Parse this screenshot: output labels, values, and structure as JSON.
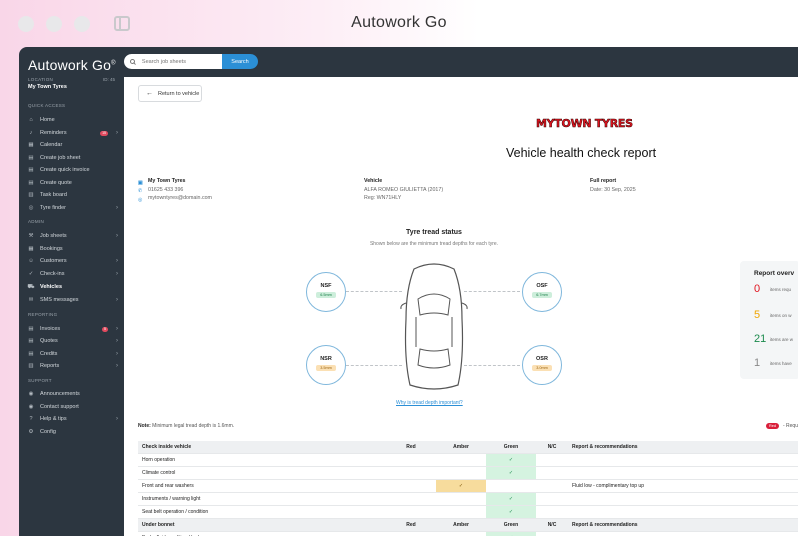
{
  "window": {
    "title": "Autowork Go"
  },
  "sidebar": {
    "logo": "Autowork Go",
    "logo_mark": "®",
    "location_label": "LOCATION",
    "location_id": "ID: 45",
    "location_name": "My Town Tyres",
    "sections": [
      {
        "label": "QUICK ACCESS",
        "items": [
          {
            "label": "Home",
            "icon": "home-icon",
            "glyph": "⌂"
          },
          {
            "label": "Reminders",
            "icon": "bell-icon",
            "glyph": "♪",
            "badge": "15",
            "chevron": true
          },
          {
            "label": "Calendar",
            "icon": "calendar-icon",
            "glyph": "▦"
          },
          {
            "label": "Create job sheet",
            "icon": "document-icon",
            "glyph": "▤"
          },
          {
            "label": "Create quick invoice",
            "icon": "document-icon",
            "glyph": "▤"
          },
          {
            "label": "Create quote",
            "icon": "document-icon",
            "glyph": "▤"
          },
          {
            "label": "Task board",
            "icon": "board-icon",
            "glyph": "▥"
          },
          {
            "label": "Tyre finder",
            "icon": "search-icon",
            "glyph": "◎",
            "chevron": true
          }
        ]
      },
      {
        "label": "ADMIN",
        "items": [
          {
            "label": "Job sheets",
            "icon": "wrench-icon",
            "glyph": "⚒",
            "chevron": true
          },
          {
            "label": "Bookings",
            "icon": "calendar-icon",
            "glyph": "▦"
          },
          {
            "label": "Customers",
            "icon": "users-icon",
            "glyph": "☺",
            "chevron": true
          },
          {
            "label": "Check-ins",
            "icon": "checkin-icon",
            "glyph": "✓",
            "chevron": true
          },
          {
            "label": "Vehicles",
            "icon": "car-icon",
            "glyph": "⛟",
            "active": true
          },
          {
            "label": "SMS messages",
            "icon": "message-icon",
            "glyph": "✉",
            "chevron": true
          }
        ]
      },
      {
        "label": "REPORTING",
        "items": [
          {
            "label": "Invoices",
            "icon": "invoice-icon",
            "glyph": "▤",
            "badge": "5",
            "chevron": true
          },
          {
            "label": "Quotes",
            "icon": "quote-icon",
            "glyph": "▤",
            "chevron": true
          },
          {
            "label": "Credits",
            "icon": "credit-icon",
            "glyph": "▤",
            "chevron": true
          },
          {
            "label": "Reports",
            "icon": "chart-icon",
            "glyph": "▥",
            "chevron": true
          }
        ]
      },
      {
        "label": "SUPPORT",
        "items": [
          {
            "label": "Announcements",
            "icon": "megaphone-icon",
            "glyph": "◉"
          },
          {
            "label": "Contact support",
            "icon": "support-icon",
            "glyph": "◉"
          },
          {
            "label": "Help & tips",
            "icon": "help-icon",
            "glyph": "?",
            "chevron": true
          },
          {
            "label": "Config",
            "icon": "gear-icon",
            "glyph": "⚙"
          }
        ]
      }
    ]
  },
  "search": {
    "placeholder": "Search job sheets",
    "button": "Search"
  },
  "page": {
    "back_label": "Return to vehicle",
    "brand_logo_text": "MYTOWN TYRES",
    "title": "Vehicle health check report",
    "company": {
      "name": "My Town Tyres",
      "phone": "01625 433 396",
      "email": "mytowntyres@domain.com"
    },
    "vehicle": {
      "heading": "Vehicle",
      "model": "ALFA ROMEO GIULIETTA (2017)",
      "reg": "Reg: WN71HLY"
    },
    "report": {
      "heading": "Full report",
      "date": "Date: 30 Sep, 2025"
    },
    "tread": {
      "title": "Tyre tread status",
      "subtitle": "Shown below are the minimum tread depths for each tyre.",
      "nsf": {
        "label": "NSF",
        "value": "6.5mm"
      },
      "osf": {
        "label": "OSF",
        "value": "6.7mm"
      },
      "nsr": {
        "label": "NSR",
        "value": "3.5mm"
      },
      "osr": {
        "label": "OSR",
        "value": "3.0mm"
      },
      "why_link": "Why is tread depth important?"
    },
    "note_label": "Note:",
    "note_text": "Minimum legal tread depth is 1.6mm.",
    "legend_pill": "Red",
    "legend_text": "- Requ",
    "summary": {
      "title": "Report overv",
      "rows": [
        {
          "n": "0",
          "text": "items requ",
          "color": "#e0141f"
        },
        {
          "n": "5",
          "text": "items on w",
          "color": "#f0a500"
        },
        {
          "n": "21",
          "text": "items are w",
          "color": "#1a8a4c"
        },
        {
          "n": "1",
          "text": "items have",
          "color": "#888888"
        }
      ]
    },
    "table": {
      "sections": [
        {
          "heading": "Check inside vehicle",
          "cols": [
            "Red",
            "Amber",
            "Green",
            "N/C",
            "Report & recommendations"
          ],
          "rows": [
            {
              "label": "Horn operation",
              "status": "green",
              "note": ""
            },
            {
              "label": "Climate control",
              "status": "green",
              "note": ""
            },
            {
              "label": "Front and rear washers",
              "status": "amber",
              "note": "Fluid low - complimentary top up"
            },
            {
              "label": "Instruments / warning light",
              "status": "green",
              "note": ""
            },
            {
              "label": "Seat belt operation / condition",
              "status": "green",
              "note": ""
            }
          ]
        },
        {
          "heading": "Under bonnet",
          "cols": [
            "Red",
            "Amber",
            "Green",
            "N/C",
            "Report & recommendations"
          ],
          "rows": [
            {
              "label": "Brake fluid condition / leaks",
              "status": "green",
              "note": ""
            }
          ]
        }
      ],
      "tick": "✓"
    }
  }
}
